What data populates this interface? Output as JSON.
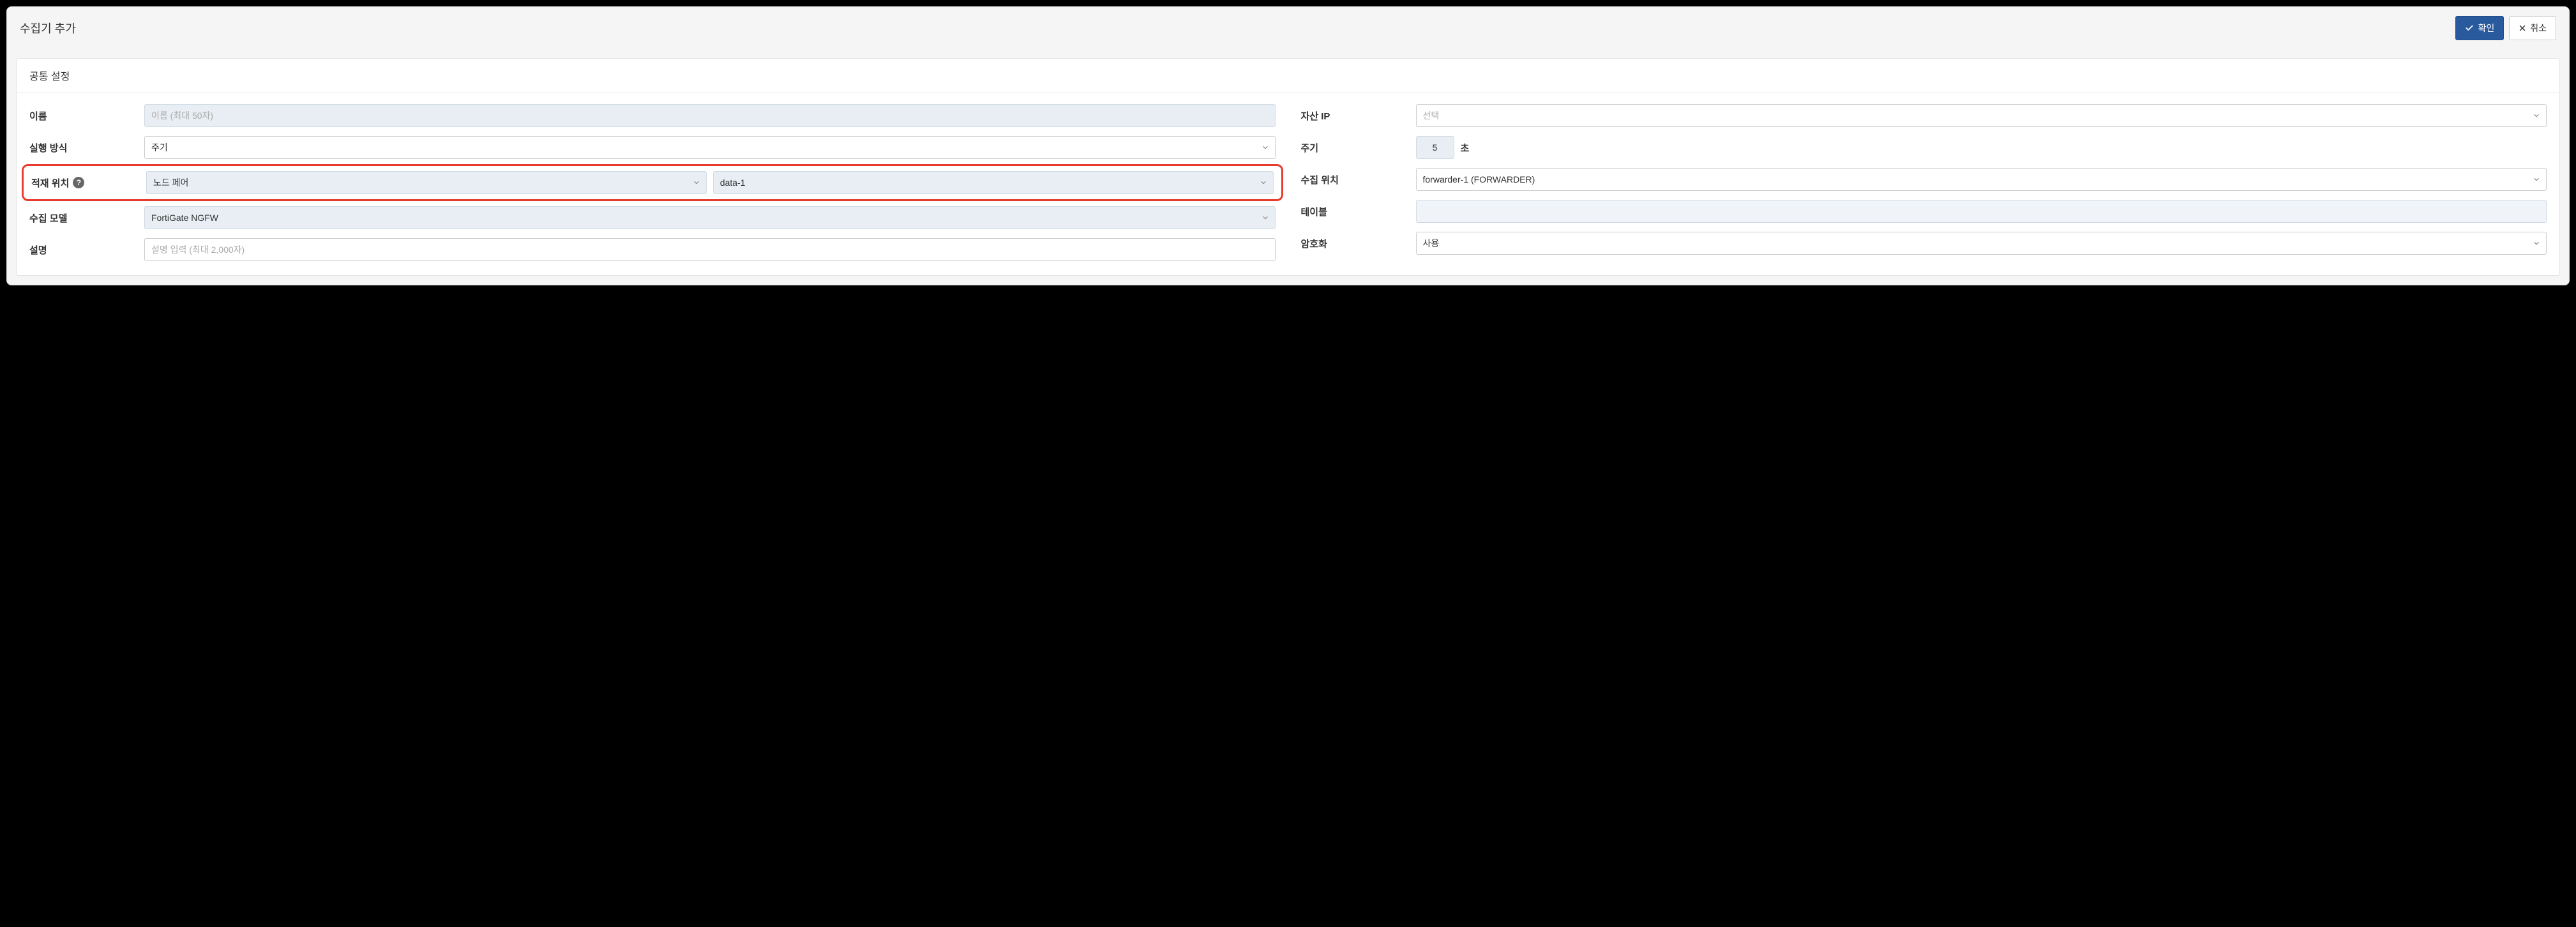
{
  "modal": {
    "title": "수집기 추가",
    "confirm": "확인",
    "cancel": "취소"
  },
  "panel": {
    "title": "공통 설정"
  },
  "left": {
    "name": {
      "label": "이름",
      "placeholder": "이름 (최대 50자)"
    },
    "execMode": {
      "label": "실행 방식",
      "value": "주기"
    },
    "loadLoc": {
      "label": "적재 위치",
      "type": "노드 페어",
      "target": "data-1"
    },
    "collectModel": {
      "label": "수집 모델",
      "value": "FortiGate NGFW"
    },
    "desc": {
      "label": "설명",
      "placeholder": "설명 입력 (최대 2,000자)"
    }
  },
  "right": {
    "assetIp": {
      "label": "자산 IP",
      "placeholder": "선택"
    },
    "period": {
      "label": "주기",
      "value": "5",
      "unit": "초"
    },
    "collectLoc": {
      "label": "수집 위치",
      "value": "forwarder-1 (FORWARDER)"
    },
    "table": {
      "label": "테이블"
    },
    "encrypt": {
      "label": "암호화",
      "value": "사용"
    }
  }
}
